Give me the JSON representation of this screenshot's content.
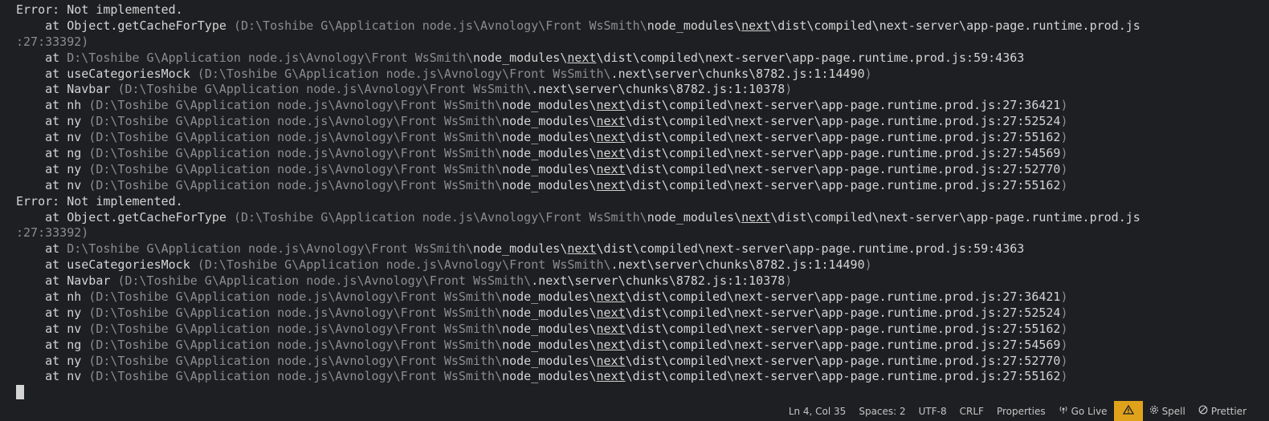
{
  "terminal": {
    "lines": [
      {
        "type": "error",
        "text": "Error: Not implemented."
      },
      {
        "type": "frame",
        "fn": "Object.getCacheForType",
        "paren": true,
        "path_prefix": "D:\\Toshibe G\\Application node.js\\Avnology\\Front WsSmith\\",
        "path_main": "node_modules\\",
        "path_ul": "next",
        "path_rest": "\\dist\\compiled\\next-server\\app-page.runtime.prod.js",
        "loc": ""
      },
      {
        "type": "cont",
        "text": ":27:33392)"
      },
      {
        "type": "frame",
        "fn": "",
        "paren": false,
        "path_prefix": "D:\\Toshibe G\\Application node.js\\Avnology\\Front WsSmith\\",
        "path_main": "node_modules\\",
        "path_ul": "next",
        "path_rest": "\\dist\\compiled\\next-server\\app-page.runtime.prod.js:59:4363",
        "loc": ""
      },
      {
        "type": "frame",
        "fn": "useCategoriesMock",
        "paren": true,
        "path_prefix": "D:\\Toshibe G\\Application node.js\\Avnology\\Front WsSmith\\",
        "path_main": ".next\\server\\chunks\\8782.js:1:14490",
        "path_ul": "",
        "path_rest": "",
        "loc": ")"
      },
      {
        "type": "frame",
        "fn": "Navbar",
        "paren": true,
        "path_prefix": "D:\\Toshibe G\\Application node.js\\Avnology\\Front WsSmith\\",
        "path_main": ".next\\server\\chunks\\8782.js:1:10378",
        "path_ul": "",
        "path_rest": "",
        "loc": ")"
      },
      {
        "type": "frame",
        "fn": "nh",
        "paren": true,
        "path_prefix": "D:\\Toshibe G\\Application node.js\\Avnology\\Front WsSmith\\",
        "path_main": "node_modules\\",
        "path_ul": "next",
        "path_rest": "\\dist\\compiled\\next-server\\app-page.runtime.prod.js:27:36421",
        "loc": ")"
      },
      {
        "type": "frame",
        "fn": "ny",
        "paren": true,
        "path_prefix": "D:\\Toshibe G\\Application node.js\\Avnology\\Front WsSmith\\",
        "path_main": "node_modules\\",
        "path_ul": "next",
        "path_rest": "\\dist\\compiled\\next-server\\app-page.runtime.prod.js:27:52524",
        "loc": ")"
      },
      {
        "type": "frame",
        "fn": "nv",
        "paren": true,
        "path_prefix": "D:\\Toshibe G\\Application node.js\\Avnology\\Front WsSmith\\",
        "path_main": "node_modules\\",
        "path_ul": "next",
        "path_rest": "\\dist\\compiled\\next-server\\app-page.runtime.prod.js:27:55162",
        "loc": ")"
      },
      {
        "type": "frame",
        "fn": "ng",
        "paren": true,
        "path_prefix": "D:\\Toshibe G\\Application node.js\\Avnology\\Front WsSmith\\",
        "path_main": "node_modules\\",
        "path_ul": "next",
        "path_rest": "\\dist\\compiled\\next-server\\app-page.runtime.prod.js:27:54569",
        "loc": ")"
      },
      {
        "type": "frame",
        "fn": "ny",
        "paren": true,
        "path_prefix": "D:\\Toshibe G\\Application node.js\\Avnology\\Front WsSmith\\",
        "path_main": "node_modules\\",
        "path_ul": "next",
        "path_rest": "\\dist\\compiled\\next-server\\app-page.runtime.prod.js:27:52770",
        "loc": ")"
      },
      {
        "type": "frame",
        "fn": "nv",
        "paren": true,
        "path_prefix": "D:\\Toshibe G\\Application node.js\\Avnology\\Front WsSmith\\",
        "path_main": "node_modules\\",
        "path_ul": "next",
        "path_rest": "\\dist\\compiled\\next-server\\app-page.runtime.prod.js:27:55162",
        "loc": ")"
      },
      {
        "type": "error",
        "text": "Error: Not implemented."
      },
      {
        "type": "frame",
        "fn": "Object.getCacheForType",
        "paren": true,
        "path_prefix": "D:\\Toshibe G\\Application node.js\\Avnology\\Front WsSmith\\",
        "path_main": "node_modules\\",
        "path_ul": "next",
        "path_rest": "\\dist\\compiled\\next-server\\app-page.runtime.prod.js",
        "loc": ""
      },
      {
        "type": "cont",
        "text": ":27:33392)"
      },
      {
        "type": "frame",
        "fn": "",
        "paren": false,
        "path_prefix": "D:\\Toshibe G\\Application node.js\\Avnology\\Front WsSmith\\",
        "path_main": "node_modules\\",
        "path_ul": "next",
        "path_rest": "\\dist\\compiled\\next-server\\app-page.runtime.prod.js:59:4363",
        "loc": ""
      },
      {
        "type": "frame",
        "fn": "useCategoriesMock",
        "paren": true,
        "path_prefix": "D:\\Toshibe G\\Application node.js\\Avnology\\Front WsSmith\\",
        "path_main": ".next\\server\\chunks\\8782.js:1:14490",
        "path_ul": "",
        "path_rest": "",
        "loc": ")"
      },
      {
        "type": "frame",
        "fn": "Navbar",
        "paren": true,
        "path_prefix": "D:\\Toshibe G\\Application node.js\\Avnology\\Front WsSmith\\",
        "path_main": ".next\\server\\chunks\\8782.js:1:10378",
        "path_ul": "",
        "path_rest": "",
        "loc": ")"
      },
      {
        "type": "frame",
        "fn": "nh",
        "paren": true,
        "path_prefix": "D:\\Toshibe G\\Application node.js\\Avnology\\Front WsSmith\\",
        "path_main": "node_modules\\",
        "path_ul": "next",
        "path_rest": "\\dist\\compiled\\next-server\\app-page.runtime.prod.js:27:36421",
        "loc": ")"
      },
      {
        "type": "frame",
        "fn": "ny",
        "paren": true,
        "path_prefix": "D:\\Toshibe G\\Application node.js\\Avnology\\Front WsSmith\\",
        "path_main": "node_modules\\",
        "path_ul": "next",
        "path_rest": "\\dist\\compiled\\next-server\\app-page.runtime.prod.js:27:52524",
        "loc": ")"
      },
      {
        "type": "frame",
        "fn": "nv",
        "paren": true,
        "path_prefix": "D:\\Toshibe G\\Application node.js\\Avnology\\Front WsSmith\\",
        "path_main": "node_modules\\",
        "path_ul": "next",
        "path_rest": "\\dist\\compiled\\next-server\\app-page.runtime.prod.js:27:55162",
        "loc": ")"
      },
      {
        "type": "frame",
        "fn": "ng",
        "paren": true,
        "path_prefix": "D:\\Toshibe G\\Application node.js\\Avnology\\Front WsSmith\\",
        "path_main": "node_modules\\",
        "path_ul": "next",
        "path_rest": "\\dist\\compiled\\next-server\\app-page.runtime.prod.js:27:54569",
        "loc": ")"
      },
      {
        "type": "frame",
        "fn": "ny",
        "paren": true,
        "path_prefix": "D:\\Toshibe G\\Application node.js\\Avnology\\Front WsSmith\\",
        "path_main": "node_modules\\",
        "path_ul": "next",
        "path_rest": "\\dist\\compiled\\next-server\\app-page.runtime.prod.js:27:52770",
        "loc": ")"
      },
      {
        "type": "frame",
        "fn": "nv",
        "paren": true,
        "path_prefix": "D:\\Toshibe G\\Application node.js\\Avnology\\Front WsSmith\\",
        "path_main": "node_modules\\",
        "path_ul": "next",
        "path_rest": "\\dist\\compiled\\next-server\\app-page.runtime.prod.js:27:55162",
        "loc": ")"
      }
    ]
  },
  "statusbar": {
    "cursor_position": "Ln 4, Col 35",
    "spaces": "Spaces: 2",
    "encoding": "UTF-8",
    "line_ending": "CRLF",
    "language": "Properties",
    "go_live": "Go Live",
    "spell": "Spell",
    "prettier": "Prettier",
    "icons": {
      "go_live": "broadcast-icon",
      "warning": "warning-icon",
      "spell": "gear-icon",
      "prettier": "blocked-icon"
    }
  },
  "colors": {
    "background": "#1e1f22",
    "text": "#d4d4d4",
    "dim_text": "#8b8d91",
    "warning_badge": "#e0a21b"
  }
}
